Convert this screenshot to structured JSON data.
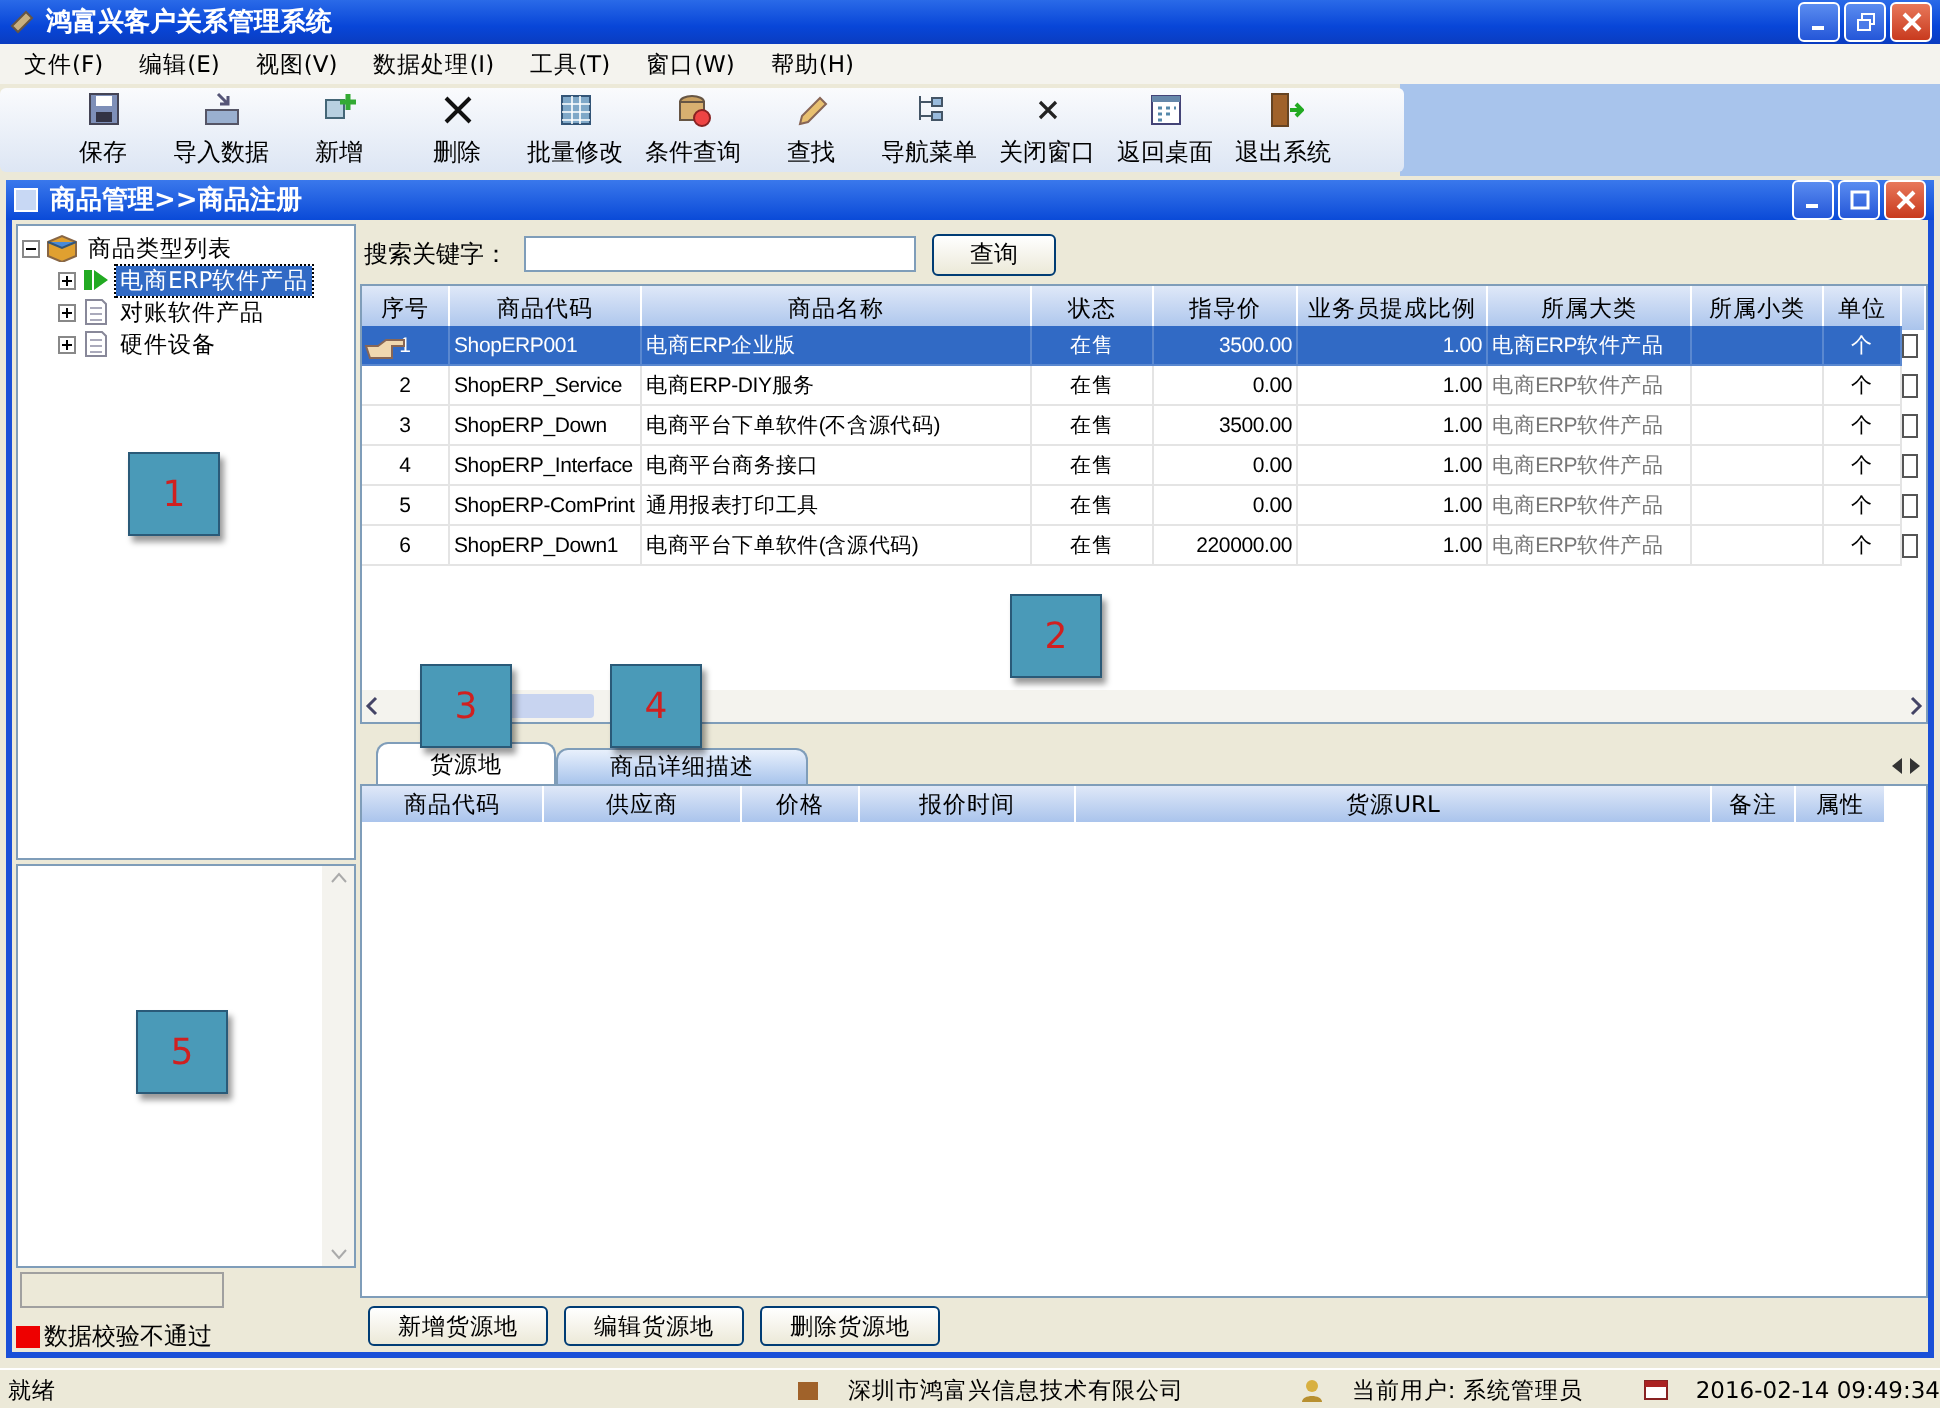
{
  "window": {
    "title": "鸿富兴客户关系管理系统"
  },
  "menu": [
    "文件(F)",
    "编辑(E)",
    "视图(V)",
    "数据处理(I)",
    "工具(T)",
    "窗口(W)",
    "帮助(H)"
  ],
  "toolbar": [
    "保存",
    "导入数据",
    "新增",
    "删除",
    "批量修改",
    "条件查询",
    "查找",
    "导航菜单",
    "关闭窗口",
    "返回桌面",
    "退出系统"
  ],
  "child_window": {
    "title": "商品管理>>商品注册"
  },
  "tree": {
    "label": "商品类型列表",
    "expanded": true,
    "children": [
      {
        "label": "电商ERP软件产品",
        "selected": true,
        "expanded": false
      },
      {
        "label": "对账软件产品",
        "selected": false,
        "expanded": false
      },
      {
        "label": "硬件设备",
        "selected": false,
        "expanded": false
      }
    ]
  },
  "legend": "数据校验不通过",
  "search": {
    "label": "搜索关键字：",
    "button": "查询"
  },
  "table": {
    "columns": [
      "序号",
      "商品代码",
      "商品名称",
      "状态",
      "指导价",
      "业务员提成比例",
      "所属大类",
      "所属小类",
      "单位"
    ],
    "rows": [
      {
        "cells": [
          "1",
          "ShopERP001",
          "电商ERP企业版",
          "在售",
          "3500.00",
          "1.00",
          "电商ERP软件产品",
          "",
          "个"
        ],
        "selected": true,
        "checked": false
      },
      {
        "cells": [
          "2",
          "ShopERP_Service",
          "电商ERP-DIY服务",
          "在售",
          "0.00",
          "1.00",
          "电商ERP软件产品",
          "",
          "个"
        ],
        "selected": false,
        "checked": false
      },
      {
        "cells": [
          "3",
          "ShopERP_Down",
          "电商平台下单软件(不含源代码)",
          "在售",
          "3500.00",
          "1.00",
          "电商ERP软件产品",
          "",
          "个"
        ],
        "selected": false,
        "checked": false
      },
      {
        "cells": [
          "4",
          "ShopERP_Interface",
          "电商平台商务接口",
          "在售",
          "0.00",
          "1.00",
          "电商ERP软件产品",
          "",
          "个"
        ],
        "selected": false,
        "checked": false
      },
      {
        "cells": [
          "5",
          "ShopERP-ComPrint",
          "通用报表打印工具",
          "在售",
          "0.00",
          "1.00",
          "电商ERP软件产品",
          "",
          "个"
        ],
        "selected": false,
        "checked": false
      },
      {
        "cells": [
          "6",
          "ShopERP_Down1",
          "电商平台下单软件(含源代码)",
          "在售",
          "220000.00",
          "1.00",
          "电商ERP软件产品",
          "",
          "个"
        ],
        "selected": false,
        "checked": false
      }
    ]
  },
  "tabs": [
    {
      "label": "货源地",
      "selected": true
    },
    {
      "label": "商品详细描述",
      "selected": false
    }
  ],
  "sub_table": {
    "columns": [
      "商品代码",
      "供应商",
      "价格",
      "报价时间",
      "货源URL",
      "备注",
      "属性"
    ]
  },
  "buttons": [
    "新增货源地",
    "编辑货源地",
    "删除货源地"
  ],
  "callouts": [
    "1",
    "2",
    "3",
    "4",
    "5"
  ],
  "status_bar": {
    "state": "就绪",
    "company": "深圳市鸿富兴信息技术有限公司",
    "user": "当前用户: 系统管理员",
    "datetime": "2016-02-14 09:49:34"
  }
}
